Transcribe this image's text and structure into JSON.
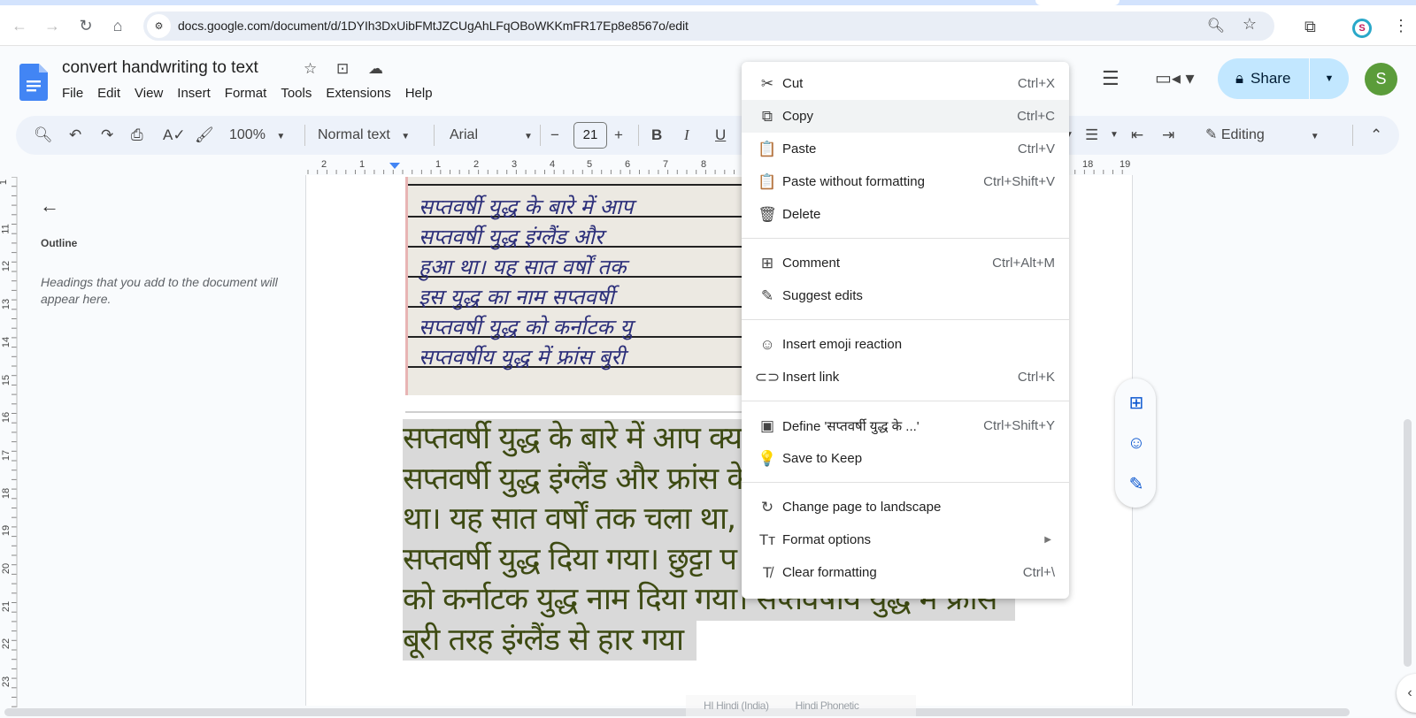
{
  "browser": {
    "url": "docs.google.com/document/d/1DYIh3DxUibFMtJZCUgAhLFqOBoWKKmFR17Ep8e8567o/edit",
    "profile_initial": "S"
  },
  "docs": {
    "title": "convert handwriting to text",
    "menus": [
      "File",
      "Edit",
      "View",
      "Insert",
      "Format",
      "Tools",
      "Extensions",
      "Help"
    ],
    "share_label": "Share",
    "avatar_initial": "S"
  },
  "toolbar": {
    "zoom": "100%",
    "style": "Normal text",
    "font": "Arial",
    "font_size": "21",
    "mode": "Editing",
    "bold": "B",
    "italic": "I",
    "underline": "U"
  },
  "ruler": {
    "horizontal": [
      "2",
      "1",
      "1",
      "2",
      "3",
      "4",
      "5",
      "6",
      "7",
      "8",
      "18",
      "19"
    ],
    "vertical": [
      "1",
      "11",
      "12",
      "13",
      "14",
      "15",
      "16",
      "17",
      "18",
      "19",
      "20",
      "21",
      "22",
      "23"
    ]
  },
  "outline": {
    "title": "Outline",
    "hint": "Headings that you add to the document will appear here."
  },
  "document": {
    "handwriting_lines": [
      "सप्तवर्षी युद्ध के बारे में आप",
      "सप्तवर्षी युद्ध इंग्लैंड और",
      "हुआ था। यह सात वर्षों तक",
      "इस युद्ध का नाम सप्तवर्षी",
      "सप्तवर्षी युद्ध को कर्नाटक यु",
      "सप्तवर्षीय युद्ध में फ्रांस बुरी"
    ],
    "text_lines": [
      "सप्तवर्षी युद्ध के बारे में आप क्या जानते हैं?",
      "सप्तवर्षी युद्ध इंग्लैंड और फ्रांस के बीच हुआ",
      "था। यह सात वर्षों तक चला था, इसलिए इसे",
      "सप्तवर्षी युद्ध दिया गया। छुट्टा प",
      "को कर्नाटक युद्ध नाम दिया गया। सप्तवर्षीय युद्ध में फ्रांस",
      "बूरी तरह इंग्लैंड से हार गया"
    ]
  },
  "context_menu": {
    "groups": [
      [
        {
          "icon": "scissors-icon",
          "glyph": "✂",
          "label": "Cut",
          "shortcut": "Ctrl+X"
        },
        {
          "icon": "copy-icon",
          "glyph": "⧉",
          "label": "Copy",
          "shortcut": "Ctrl+C",
          "highlighted": true
        },
        {
          "icon": "paste-icon",
          "glyph": "📋",
          "label": "Paste",
          "shortcut": "Ctrl+V"
        },
        {
          "icon": "paste-plain-icon",
          "glyph": "📋",
          "label": "Paste without formatting",
          "shortcut": "Ctrl+Shift+V"
        },
        {
          "icon": "trash-icon",
          "glyph": "🗑",
          "label": "Delete",
          "shortcut": ""
        }
      ],
      [
        {
          "icon": "add-comment-icon",
          "glyph": "⊞",
          "label": "Comment",
          "shortcut": "Ctrl+Alt+M"
        },
        {
          "icon": "suggest-edit-icon",
          "glyph": "✎",
          "label": "Suggest edits",
          "shortcut": ""
        }
      ],
      [
        {
          "icon": "emoji-icon",
          "glyph": "☺",
          "label": "Insert emoji reaction",
          "shortcut": ""
        },
        {
          "icon": "link-icon",
          "glyph": "⊂⊃",
          "label": "Insert link",
          "shortcut": "Ctrl+K"
        }
      ],
      [
        {
          "icon": "dictionary-icon",
          "glyph": "▣",
          "label": "Define 'सप्तवर्षी युद्ध के ...'",
          "shortcut": "Ctrl+Shift+Y"
        },
        {
          "icon": "lightbulb-icon",
          "glyph": "💡",
          "label": "Save to Keep",
          "shortcut": ""
        }
      ],
      [
        {
          "icon": "rotate-page-icon",
          "glyph": "↻",
          "label": "Change page to landscape",
          "shortcut": ""
        },
        {
          "icon": "text-format-icon",
          "glyph": "Tт",
          "label": "Format options",
          "shortcut": "",
          "submenu": true
        },
        {
          "icon": "clear-format-icon",
          "glyph": "T̸",
          "label": "Clear formatting",
          "shortcut": "Ctrl+\\"
        }
      ]
    ]
  },
  "status": {
    "language": "HI  Hindi (India)",
    "input_tool": "Hindi Phonetic"
  }
}
